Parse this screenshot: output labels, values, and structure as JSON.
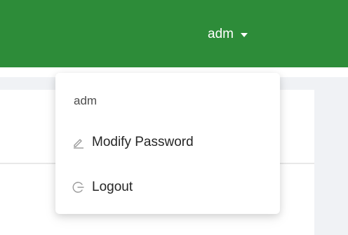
{
  "header": {
    "username": "adm",
    "caret_icon": "caret-down-icon",
    "background_color": "#2d8c39"
  },
  "dropdown": {
    "username": "adm",
    "items": [
      {
        "label": "Modify Password",
        "icon": "edit-icon"
      },
      {
        "label": "Logout",
        "icon": "logout-icon"
      }
    ]
  },
  "panel": {
    "expand_icon": "chevron-down-icon"
  }
}
